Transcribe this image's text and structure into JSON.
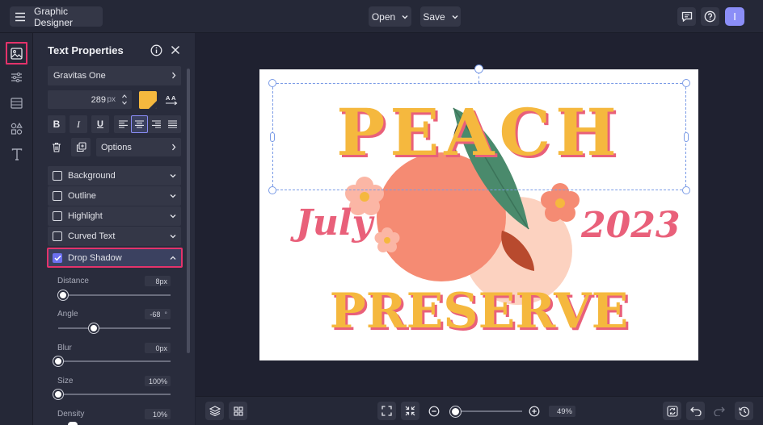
{
  "app": {
    "title": "Graphic Designer",
    "avatar_initial": "I"
  },
  "header": {
    "open_label": "Open",
    "save_label": "Save"
  },
  "panel": {
    "title": "Text Properties",
    "font_name": "Gravitas One",
    "font_size": "289",
    "font_size_unit": "px",
    "text_color": "#f5b83e",
    "options_label": "Options",
    "sections": [
      {
        "label": "Background",
        "checked": false
      },
      {
        "label": "Outline",
        "checked": false
      },
      {
        "label": "Highlight",
        "checked": false
      },
      {
        "label": "Curved Text",
        "checked": false
      },
      {
        "label": "Drop Shadow",
        "checked": true
      }
    ],
    "shadow": {
      "distance_label": "Distance",
      "distance_value": "8px",
      "distance_level": 0.04,
      "angle_label": "Angle",
      "angle_value": "-68",
      "angle_unit": "°",
      "angle_level": 0.32,
      "blur_label": "Blur",
      "blur_value": "0px",
      "blur_level": 0,
      "size_label": "Size",
      "size_value": "100%",
      "size_level": 0,
      "density_label": "Density",
      "density_value": "10%"
    }
  },
  "canvas": {
    "line1": "PEACH",
    "line2_left": "July",
    "line2_right": "2023",
    "line3": "PRESERVE"
  },
  "bottom": {
    "zoom_value": "49%",
    "zoom_level": 0.08
  },
  "colors": {
    "accent": "#e4336b",
    "brand": "#8b8ef7",
    "peach_yellow": "#f5b83e",
    "peach_pink": "#e9607a"
  }
}
